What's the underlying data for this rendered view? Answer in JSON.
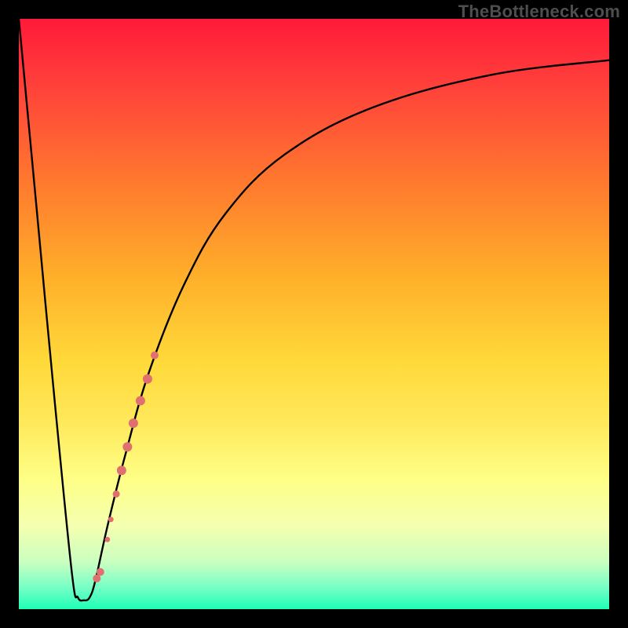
{
  "watermark": "TheBottleneck.com",
  "colors": {
    "curve": "#000000",
    "marker": "#e07070",
    "frame": "#000000"
  },
  "chart_data": {
    "type": "line",
    "title": "",
    "xlabel": "",
    "ylabel": "",
    "xlim": [
      0,
      100
    ],
    "ylim": [
      0,
      100
    ],
    "grid": false,
    "series": [
      {
        "name": "bottleneck-curve",
        "x": [
          0,
          3,
          6,
          9,
          10,
          11,
          12,
          13,
          15,
          18,
          22,
          28,
          35,
          45,
          60,
          80,
          100
        ],
        "y": [
          100,
          68,
          36,
          6,
          2,
          1.5,
          2,
          5,
          14,
          26,
          40,
          55,
          67,
          77,
          85,
          90.5,
          93
        ]
      }
    ],
    "markers": [
      {
        "x": 13.2,
        "y": 5.2,
        "r": 5
      },
      {
        "x": 13.8,
        "y": 6.3,
        "r": 5
      },
      {
        "x": 15.0,
        "y": 11.8,
        "r": 3.4
      },
      {
        "x": 15.6,
        "y": 15.2,
        "r": 3.4
      },
      {
        "x": 16.5,
        "y": 19.5,
        "r": 4.5
      },
      {
        "x": 17.4,
        "y": 23.5,
        "r": 6
      },
      {
        "x": 18.4,
        "y": 27.5,
        "r": 6
      },
      {
        "x": 19.4,
        "y": 31.5,
        "r": 6
      },
      {
        "x": 20.6,
        "y": 35.3,
        "r": 6
      },
      {
        "x": 21.8,
        "y": 39.0,
        "r": 6
      },
      {
        "x": 23.0,
        "y": 43.0,
        "r": 5
      }
    ]
  }
}
